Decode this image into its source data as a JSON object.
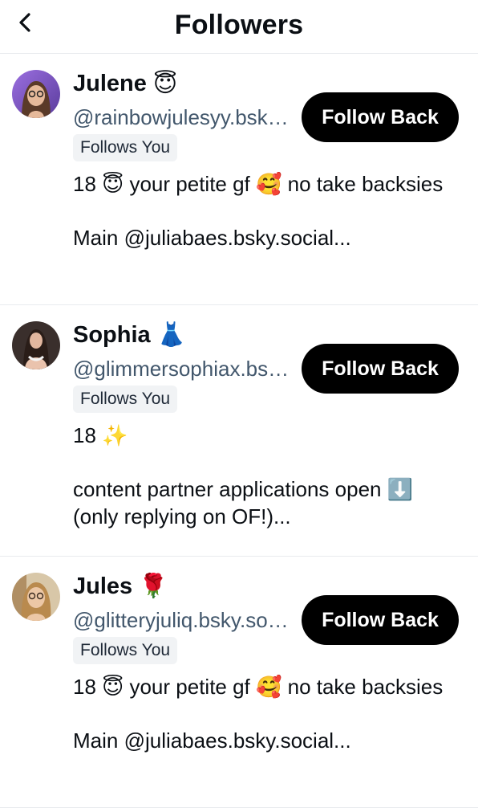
{
  "header": {
    "title": "Followers",
    "back_icon": "chevron-left-icon"
  },
  "followers": [
    {
      "name": "Julene",
      "name_emoji": "😇",
      "handle": "@rainbowjulesyy.bsky.social",
      "badge": "Follows You",
      "button": "Follow Back",
      "bio": "18 😇 your petite gf 🥰 no take backsies\n\nMain @juliabaes.bsky.social..."
    },
    {
      "name": "Sophia",
      "name_emoji": "👗",
      "handle": "@glimmersophiax.bsky.social",
      "badge": "Follows You",
      "button": "Follow Back",
      "bio": "18 ✨\n\ncontent partner applications open ⬇️ (only replying on OF!)..."
    },
    {
      "name": "Jules",
      "name_emoji": "🌹",
      "handle": "@glitteryjuliq.bsky.social",
      "badge": "Follows You",
      "button": "Follow Back",
      "bio": "18 😇 your petite gf 🥰 no take backsies\n\nMain @juliabaes.bsky.social..."
    }
  ],
  "colors": {
    "button_bg": "#000000",
    "handle": "#42576c",
    "badge_bg": "#f1f3f5",
    "divider": "#e8ebee"
  }
}
